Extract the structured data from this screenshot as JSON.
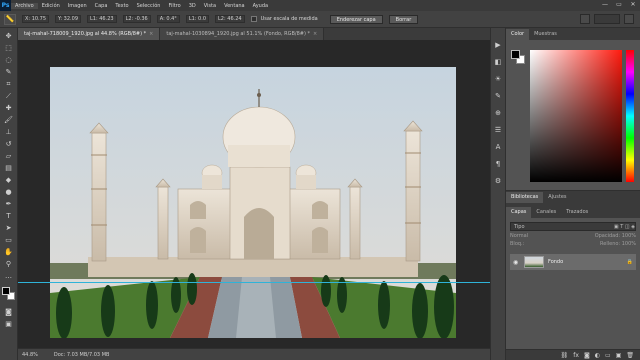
{
  "app": {
    "logo": "Ps",
    "menu": [
      "Archivo",
      "Edición",
      "Imagen",
      "Capa",
      "Texto",
      "Selección",
      "Filtro",
      "3D",
      "Vista",
      "Ventana",
      "Ayuda"
    ],
    "window_controls": [
      "—",
      "▭",
      "✕"
    ]
  },
  "options": {
    "x": "X: 10.75",
    "y": "Y: 32.09",
    "l1": "L1: 46.23",
    "l2": "L2: -0.36",
    "a": "A: 0.4°",
    "l1b": "L1: 0.0",
    "l2b": "L2: 46.24",
    "use_scale": "Usar escala de medida",
    "straighten": "Enderezar capa",
    "clear": "Borrar"
  },
  "tabs": [
    {
      "label": "taj-mahal-718009_1920.jpg al 44.8% (RGB/8#) *"
    },
    {
      "label": "taj-mahal-1030894_1920.jpg al 51.1% (Fondo, RGB/8#) *"
    }
  ],
  "status": {
    "zoom": "44.8%",
    "doc": "Doc: 7.03 MB/7.03 MB"
  },
  "panels": {
    "color_tab": "Color",
    "swatches_tab": "Muestras",
    "libs_tabs": [
      "Bibliotecas",
      "Ajustes"
    ],
    "layers_tabs": [
      "Capas",
      "Canales",
      "Trazados"
    ],
    "filter_placeholder": "Tipo",
    "blend_mode": "Normal",
    "opacity_label": "Opacidad:",
    "opacity_value": "100%",
    "lock_label": "Bloq.:",
    "fill_label": "Relleno:",
    "fill_value": "100%",
    "layer_name": "Fondo"
  }
}
